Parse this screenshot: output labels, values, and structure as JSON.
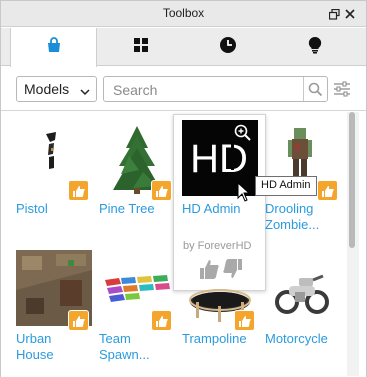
{
  "window": {
    "title": "Toolbox",
    "restore_icon": "restore-icon",
    "close_icon": "close-icon"
  },
  "tabs": [
    {
      "name": "marketplace",
      "icon": "bag-icon",
      "active": true
    },
    {
      "name": "inventory",
      "icon": "grid-icon",
      "active": false
    },
    {
      "name": "recent",
      "icon": "clock-icon",
      "active": false
    },
    {
      "name": "creations",
      "icon": "lightbulb-icon",
      "active": false
    }
  ],
  "toolbar": {
    "category": "Models",
    "search_placeholder": "Search"
  },
  "items": [
    {
      "name": "Pistol"
    },
    {
      "name": "Pine Tree"
    },
    {
      "name": "HD Admin",
      "by": "by ForeverHD"
    },
    {
      "name": "Drooling Zombie..."
    },
    {
      "name": "Urban House"
    },
    {
      "name": "Team Spawn..."
    },
    {
      "name": "Trampoline"
    },
    {
      "name": "Motorcycle"
    }
  ],
  "tooltip": "HD Admin",
  "colors": {
    "accent": "#2b9bde",
    "badge": "#f4a52c"
  }
}
